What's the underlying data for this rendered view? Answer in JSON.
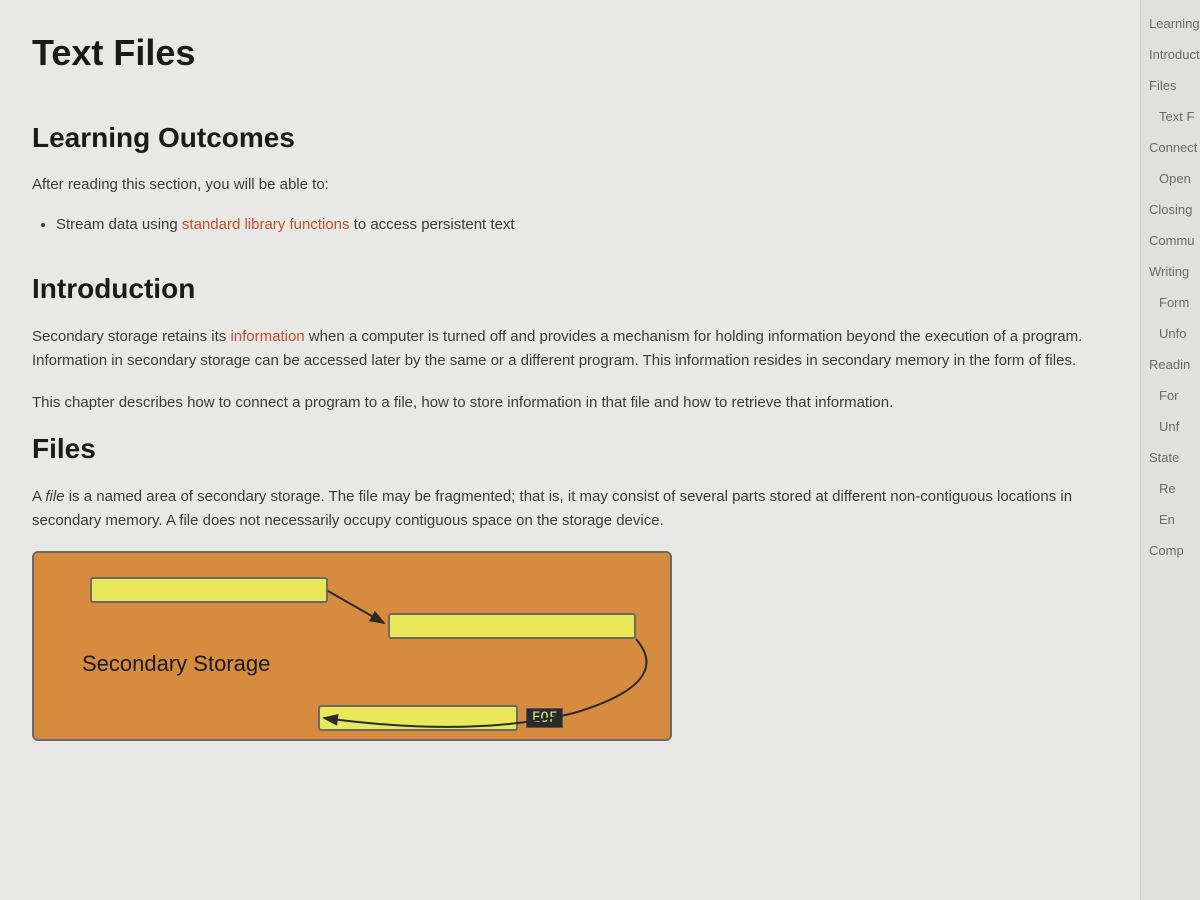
{
  "page_title": "Text Files",
  "sections": {
    "learning_outcomes": {
      "heading": "Learning Outcomes",
      "intro": "After reading this section, you will be able to:",
      "bullet_prefix": "Stream data using ",
      "bullet_link": "standard library functions",
      "bullet_suffix": " to access persistent text"
    },
    "introduction": {
      "heading": "Introduction",
      "para1_prefix": "Secondary storage retains its ",
      "para1_link": "information",
      "para1_suffix": " when a computer is turned off and provides a mechanism for holding information beyond the execution of a program. Information in secondary storage can be accessed later by the same or a different program. This information resides in secondary memory in the form of files.",
      "para2": "This chapter describes how to connect a program to a file, how to store information in that file and how to retrieve that information."
    },
    "files": {
      "heading": "Files",
      "para_prefix": "A ",
      "para_italic": "file",
      "para_suffix": " is a named area of secondary storage. The file may be fragmented; that is, it may consist of several parts stored at different non-contiguous locations in secondary memory. A file does not necessarily occupy contiguous space on the storage device."
    }
  },
  "diagram": {
    "label": "Secondary Storage",
    "eof": "EOF"
  },
  "sidebar": {
    "items": [
      {
        "label": "Learning",
        "indent": 0
      },
      {
        "label": "Introduct",
        "indent": 0
      },
      {
        "label": "Files",
        "indent": 0
      },
      {
        "label": "Text F",
        "indent": 1
      },
      {
        "label": "Connect",
        "indent": 0
      },
      {
        "label": "Open",
        "indent": 1
      },
      {
        "label": "Closing",
        "indent": 0
      },
      {
        "label": "Commu",
        "indent": 0
      },
      {
        "label": "Writing",
        "indent": 0
      },
      {
        "label": "Form",
        "indent": 1
      },
      {
        "label": "Unfo",
        "indent": 1
      },
      {
        "label": "Readin",
        "indent": 0
      },
      {
        "label": "For",
        "indent": 1
      },
      {
        "label": "Unf",
        "indent": 1
      },
      {
        "label": "State",
        "indent": 0
      },
      {
        "label": "Re",
        "indent": 1
      },
      {
        "label": "En",
        "indent": 1
      },
      {
        "label": "Comp",
        "indent": 0
      }
    ]
  }
}
